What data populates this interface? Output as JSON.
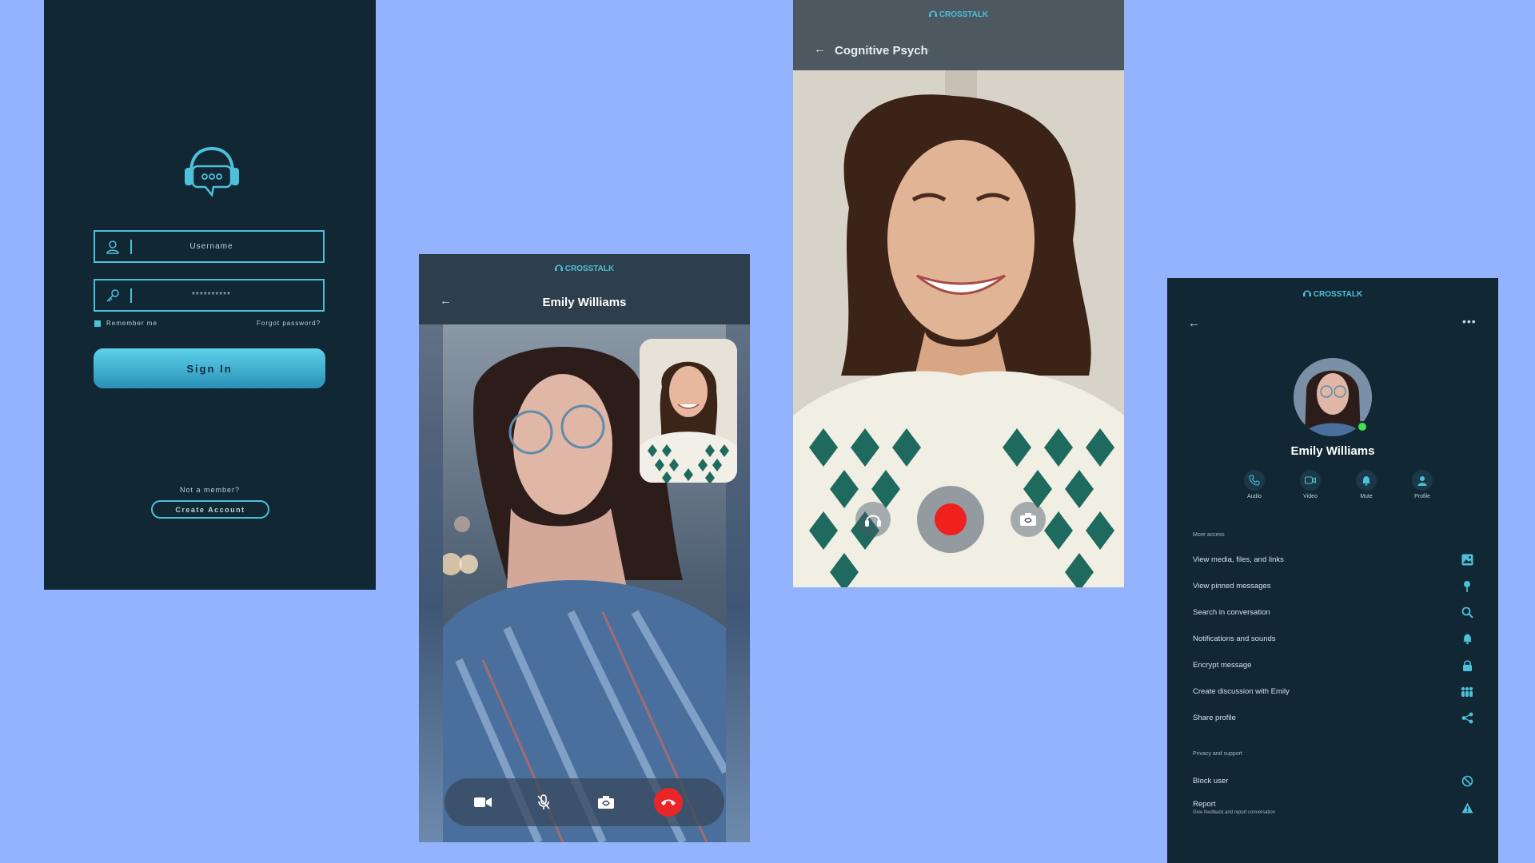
{
  "login": {
    "username_placeholder": "Username",
    "password_value": "**********",
    "remember_label": "Remember me",
    "forgot_label": "Forgot password?",
    "signin_label": "Sign In",
    "not_member": "Not a member?",
    "create_label": "Create Account"
  },
  "brand": {
    "name": "CROSSTALK",
    "accent": "#4cc1d9"
  },
  "video_call": {
    "contact_name": "Emily Williams",
    "controls": [
      "camera-icon",
      "microphone-muted-icon",
      "switch-camera-icon",
      "hang-up-icon"
    ],
    "hangup_color": "#e92527"
  },
  "recording_call": {
    "title": "Cognitive Psych",
    "controls": [
      "headphones-icon",
      "record-icon",
      "switch-camera-icon"
    ],
    "record_color": "#f0201f"
  },
  "profile": {
    "name": "Emily Williams",
    "status_color": "#3ee44a",
    "actions": [
      {
        "label": "Audio",
        "icon": "phone-icon"
      },
      {
        "label": "Video",
        "icon": "video-icon"
      },
      {
        "label": "Mute",
        "icon": "bell-icon"
      },
      {
        "label": "Profile",
        "icon": "person-icon"
      }
    ],
    "more_access_label": "More access",
    "more_access": [
      {
        "label": "View media, files, and links",
        "icon": "image-icon"
      },
      {
        "label": "View pinned messages",
        "icon": "pin-icon"
      },
      {
        "label": "Search in conversation",
        "icon": "search-icon"
      },
      {
        "label": "Notifications and sounds",
        "icon": "bell-icon"
      },
      {
        "label": "Encrypt message",
        "icon": "lock-icon"
      },
      {
        "label": "Create discussion with Emily",
        "icon": "group-icon"
      },
      {
        "label": "Share profile",
        "icon": "share-icon"
      }
    ],
    "privacy_label": "Privacy and support",
    "privacy": [
      {
        "label": "Block user",
        "icon": "block-icon",
        "sub": ""
      },
      {
        "label": "Report",
        "icon": "warning-icon",
        "sub": "Give feedback and report conversation"
      }
    ]
  }
}
